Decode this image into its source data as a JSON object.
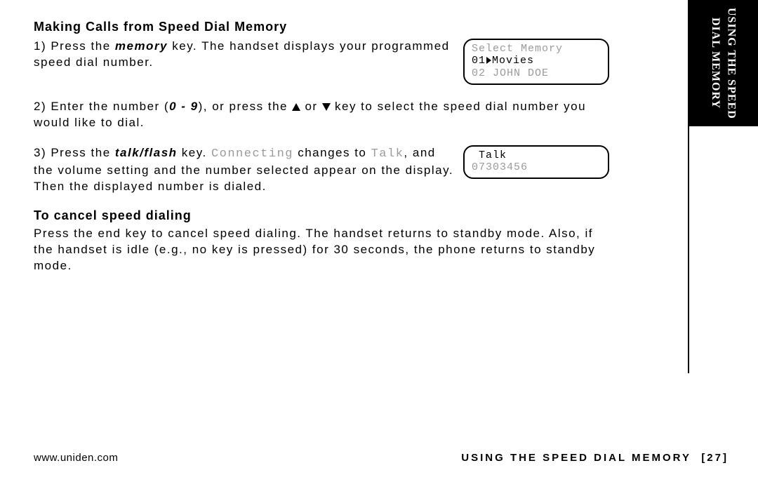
{
  "side_tab": {
    "line1": "USING THE SPEED",
    "line2": "DIAL MEMORY"
  },
  "heading": "Making Calls from Speed Dial Memory",
  "step1": {
    "prefix": "1) Press the ",
    "key": "memory",
    "rest1": " key. The handset displays your programmed speed dial number."
  },
  "lcd1": {
    "l1": "Select Memory",
    "l2a": "01",
    "l2b": "Movies",
    "l3": "02 JOHN DOE"
  },
  "step2": {
    "a": "2) Enter the number (",
    "range": "0 - 9",
    "b": "), or press the ",
    "c": " or ",
    "d": " key to select the speed dial number you would like to dial."
  },
  "step3": {
    "a": "3) Press the ",
    "key": "talk/flash",
    "b": " key. ",
    "conn": "Connecting",
    "c": " changes to ",
    "talk": "Talk",
    "d": ", and the volume setting and the number selected appear on the display. Then the displayed number is dialed."
  },
  "lcd2": {
    "l1": " Talk",
    "l2": "07303456"
  },
  "cancel_head": "To cancel speed dialing",
  "cancel": {
    "a": "Press the ",
    "key": "end",
    "b": " key to cancel speed dialing. The handset returns to standby mode. Also, if the handset is idle (e.g., no key is pressed) for 30 seconds, the phone returns to standby mode."
  },
  "footer": {
    "url": "www.uniden.com",
    "section": "USING THE SPEED DIAL MEMORY",
    "page": "[27]"
  }
}
